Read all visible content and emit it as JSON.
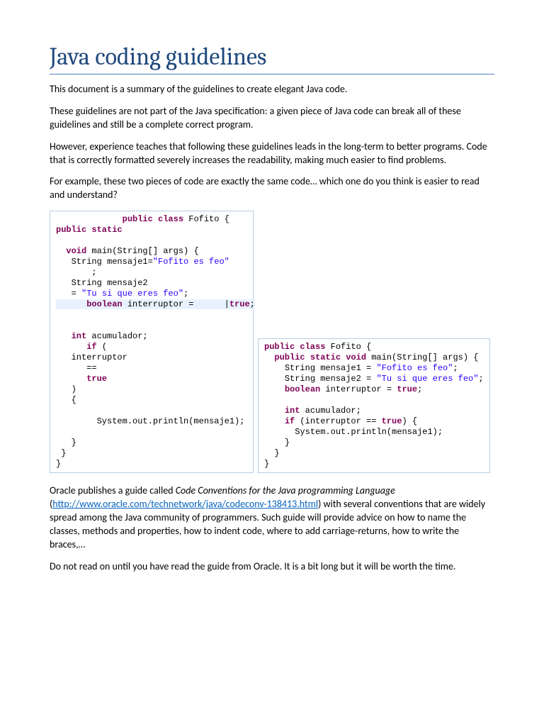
{
  "title": "Java coding guidelines",
  "paragraphs": {
    "p1": "This document is a summary of the guidelines to create elegant Java code.",
    "p2": "These guidelines are not part of the Java specification: a given piece of Java code can break all of these guidelines and still be a complete correct program.",
    "p3": "However, experience teaches that following these guidelines leads in the long-term to better programs. Code that is correctly formatted severely increases the readability, making much easier to find problems.",
    "p4": "For example, these two pieces of code are exactly the same code… which one do you think is easier to read and understand?",
    "p5a": "Oracle publishes a guide called ",
    "p5italic": "Code Conventions for the Java programming Language",
    "p5b": " (",
    "p5link": "http://www.oracle.com/technetwork/java/codeconv-138413.html",
    "p5c": ") with several conventions that are widely spread among the Java community of programmers. Such guide will provide advice on how to name the classes, methods and properties, how to indent code, where to add carriage-returns, how to write the braces,…",
    "p6": "Do not read on until you have read the guide from Oracle. It is a bit long but it will be worth the time."
  },
  "code_left": {
    "public_class": "public class",
    "classname": "Fofito",
    "public_static": "public static",
    "void": "void",
    "main_sig": "main(String[] args) {",
    "str_decl": "String mensaje1=",
    "str1": "\"Fofito es feo\"",
    "semi": ";",
    "str_decl2": "String mensaje2",
    "eq": "= ",
    "str2": "\"Tu si que eres feo\"",
    "bool": "boolean",
    "inter": "interruptor = ",
    "true": "true",
    "int": "int",
    "acum": "acumulador;",
    "if": "if",
    "open": "(",
    "interruptor": "interruptor",
    "eqeq": "==",
    "close": ")",
    "brace": "{",
    "println": "System.out.println(mensaje1);",
    "cbrace": "}"
  },
  "code_right": {
    "public_class": "public class",
    "classname": "Fofito",
    "public_static_void": "public static void",
    "main_sig": "main(String[] args) {",
    "s1": "String mensaje1 = ",
    "str1": "\"Fofito es feo\"",
    "s2": "String mensaje2 = ",
    "str2": "\"Tu si que eres feo\"",
    "bool": "boolean",
    "inter": " interruptor = ",
    "true": "true",
    "int": "int",
    "acum": " acumulador;",
    "if": "if",
    "cond_a": " (interruptor == ",
    "cond_b": ") {",
    "println": "System.out.println(mensaje1);",
    "cbrace": "}"
  }
}
